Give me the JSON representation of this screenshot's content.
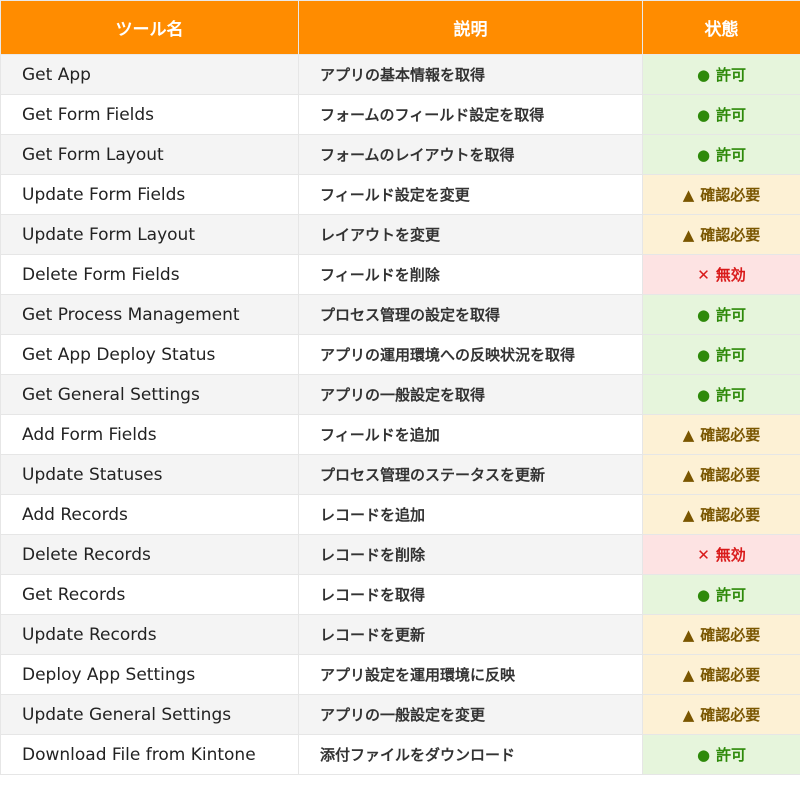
{
  "header": {
    "col_tool": "ツール名",
    "col_desc": "説明",
    "col_status": "状態"
  },
  "colors": {
    "header_bg": "#ff8c00",
    "allow": "#2e8a0a",
    "confirm": "#7a5600",
    "disabled": "#d91a1a"
  },
  "rows": [
    {
      "name": "Get App",
      "desc": "アプリの基本情報を取得",
      "status": "allow",
      "icon": "●",
      "status_label": "許可"
    },
    {
      "name": "Get Form Fields",
      "desc": "フォームのフィールド設定を取得",
      "status": "allow",
      "icon": "●",
      "status_label": "許可"
    },
    {
      "name": "Get Form Layout",
      "desc": "フォームのレイアウトを取得",
      "status": "allow",
      "icon": "●",
      "status_label": "許可"
    },
    {
      "name": "Update Form Fields",
      "desc": "フィールド設定を変更",
      "status": "confirm",
      "icon": "▲",
      "status_label": "確認必要"
    },
    {
      "name": "Update Form Layout",
      "desc": "レイアウトを変更",
      "status": "confirm",
      "icon": "▲",
      "status_label": "確認必要"
    },
    {
      "name": "Delete Form Fields",
      "desc": "フィールドを削除",
      "status": "disabled",
      "icon": "✕",
      "status_label": "無効"
    },
    {
      "name": "Get Process Management",
      "desc": "プロセス管理の設定を取得",
      "status": "allow",
      "icon": "●",
      "status_label": "許可"
    },
    {
      "name": "Get App Deploy Status",
      "desc": "アプリの運用環境への反映状況を取得",
      "status": "allow",
      "icon": "●",
      "status_label": "許可"
    },
    {
      "name": "Get General Settings",
      "desc": "アプリの一般設定を取得",
      "status": "allow",
      "icon": "●",
      "status_label": "許可"
    },
    {
      "name": "Add Form Fields",
      "desc": "フィールドを追加",
      "status": "confirm",
      "icon": "▲",
      "status_label": "確認必要"
    },
    {
      "name": "Update Statuses",
      "desc": "プロセス管理のステータスを更新",
      "status": "confirm",
      "icon": "▲",
      "status_label": "確認必要"
    },
    {
      "name": "Add Records",
      "desc": "レコードを追加",
      "status": "confirm",
      "icon": "▲",
      "status_label": "確認必要"
    },
    {
      "name": "Delete Records",
      "desc": "レコードを削除",
      "status": "disabled",
      "icon": "✕",
      "status_label": "無効"
    },
    {
      "name": "Get Records",
      "desc": "レコードを取得",
      "status": "allow",
      "icon": "●",
      "status_label": "許可"
    },
    {
      "name": "Update Records",
      "desc": "レコードを更新",
      "status": "confirm",
      "icon": "▲",
      "status_label": "確認必要"
    },
    {
      "name": "Deploy App Settings",
      "desc": "アプリ設定を運用環境に反映",
      "status": "confirm",
      "icon": "▲",
      "status_label": "確認必要"
    },
    {
      "name": "Update General Settings",
      "desc": "アプリの一般設定を変更",
      "status": "confirm",
      "icon": "▲",
      "status_label": "確認必要"
    },
    {
      "name": "Download File from Kintone",
      "desc": "添付ファイルをダウンロード",
      "status": "allow",
      "icon": "●",
      "status_label": "許可"
    }
  ]
}
